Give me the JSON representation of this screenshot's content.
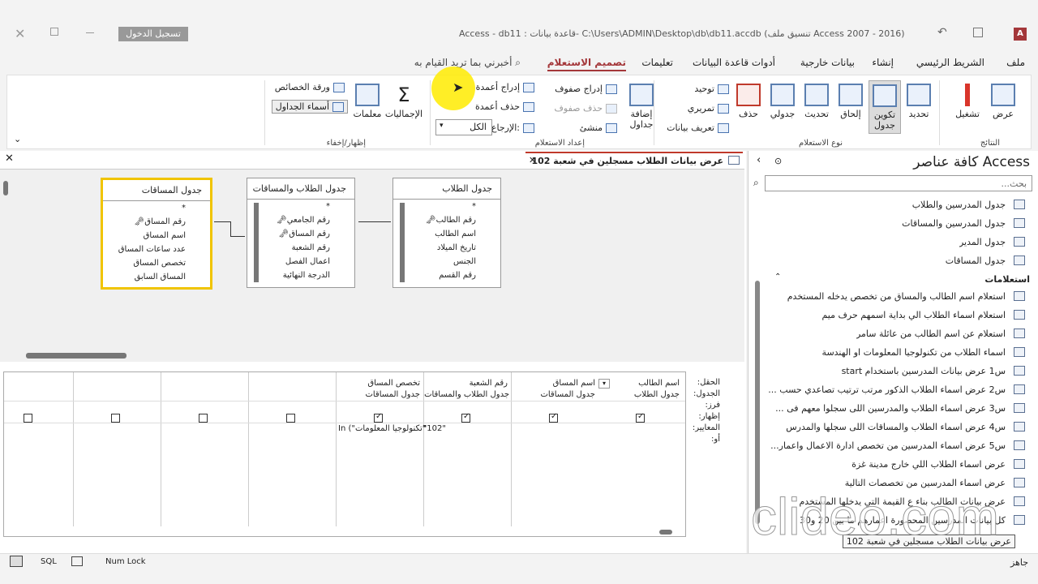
{
  "title": {
    "app": "Access",
    "path": "db11 : قاعدة بيانات- C:\\Users\\ADMIN\\Desktop\\db\\db11.accdb (تنسيق ملف Access 2007 - 2016)",
    "signin": "تسجيل الدخول"
  },
  "tabs": [
    "ملف",
    "الشريط الرئيسي",
    "إنشاء",
    "بيانات خارجية",
    "أدوات قاعدة البيانات",
    "تعليمات",
    "تصميم الاستعلام"
  ],
  "tellme": "أخبرني بما تريد القيام به",
  "ribbon": {
    "results": {
      "label": "النتائج",
      "view": "عرض",
      "run": "تشغيل"
    },
    "querytype": {
      "label": "نوع الاستعلام",
      "select": "تحديد",
      "maketable": "تكوين جدول",
      "append": "إلحاق",
      "update": "تحديث",
      "crosstab": "جدولي",
      "delete": "حذف",
      "union": "توحيد",
      "passthrough": "تمريري",
      "datadef": "تعريف بيانات"
    },
    "setup": {
      "label": "إعداد الاستعلام",
      "addtables": "إضافة جداول",
      "insertrows": "إدراج صفوف",
      "deleterows": "حذف صفوف",
      "builder": "منشئ",
      "insertcols": "إدراج أعمدة",
      "deletecols": "حذف أعمدة",
      "return": "الإرجاع:",
      "return_value": "الكل"
    },
    "showhide": {
      "label": "إظهار/إخفاء",
      "totals": "الإجماليات",
      "params": "معلمات",
      "propsheet": "ورقة الخصائص",
      "tablenames": "أسماء الجداول"
    }
  },
  "doctab": "عرض بيانات الطلاب مسجلين في شعبة 102",
  "tables": [
    {
      "title": "جدول الطلاب",
      "fields": [
        "*",
        "رقم الطالب",
        "اسم الطالب",
        "تاريخ الميلاد",
        "الجنس",
        "رقم القسم"
      ]
    },
    {
      "title": "جدول الطلاب والمساقات",
      "fields": [
        "*",
        "رقم الجامعي",
        "رقم المساق",
        "رقم الشعبة",
        "اعمال الفصل",
        "الدرجة النهائية"
      ]
    },
    {
      "title": "جدول المساقات",
      "fields": [
        "*",
        "رقم المساق",
        "اسم المساق",
        "عدد ساعات المساق",
        "تخصص المساق",
        "المساق السابق"
      ]
    }
  ],
  "grid": {
    "rowlabels": [
      "الحقل:",
      "الجدول:",
      "فرز:",
      "إظهار:",
      "المعايير:",
      "أو:"
    ],
    "columns": [
      {
        "field": "اسم الطالب",
        "table": "جدول الطلاب",
        "show": true,
        "criteria": ""
      },
      {
        "field": "اسم المساق",
        "table": "جدول المساقات",
        "show": true,
        "criteria": ""
      },
      {
        "field": "رقم الشعبة",
        "table": "جدول الطلاب والمساقات",
        "show": true,
        "criteria": "\"102\""
      },
      {
        "field": "تخصص المساق",
        "table": "جدول المساقات",
        "show": true,
        "criteria": "In (\"تكنولوجيا المعلومات\""
      },
      {
        "field": "",
        "table": "",
        "show": false,
        "criteria": ""
      },
      {
        "field": "",
        "table": "",
        "show": false,
        "criteria": ""
      },
      {
        "field": "",
        "table": "",
        "show": false,
        "criteria": ""
      },
      {
        "field": "",
        "table": "",
        "show": false,
        "criteria": ""
      }
    ]
  },
  "nav": {
    "title": "كافة عناصر Access",
    "search_placeholder": "بحث...",
    "tables": [
      "جدول المدرسين والطلاب",
      "جدول المدرسين والمساقات",
      "جدول المدير",
      "جدول المساقات"
    ],
    "queries_header": "استعلامات",
    "queries": [
      "استعلام اسم الطالب والمساق من تخصص يدخله المستخدم",
      "استعلام اسماء الطلاب الي بداية اسمهم حرف ميم",
      "استعلام عن اسم الطالب من عائلة سامر",
      "اسماء الطلاب من تكنولوجيا المعلومات او الهندسة",
      "س1 عرض بيانات المدرسين باستخدام start",
      "س2 عرض اسماء الطلاب الذكور مرتب ترتيب تصاعدي حسب ...",
      "س3 عرض اسماء الطلاب والمدرسين اللى سجلوا معهم فى ...",
      "س4 عرض اسماء الطلاب والمساقات اللى سجلها والمدرس",
      "س5 عرض اسماء المدرسين من تخصص ادارة الاعمال واعمار...",
      "عرض اسماء الطلاب اللي خارج مدينة غزة",
      "عرض اسماء المدرسين من تخصصات التالية",
      "عرض بيانات الطالب بناء ع القيمة التي يدخلها المستخدم",
      "كل بيانات المدرسين المحصورة اعمارهم ما بين 20 و30",
      "عرض بيانات الطلاب مسجلين في شعبة 102"
    ]
  },
  "status": {
    "ready": "جاهز",
    "numlock": "Num Lock",
    "sql": "SQL"
  },
  "watermark": "clideo.com"
}
